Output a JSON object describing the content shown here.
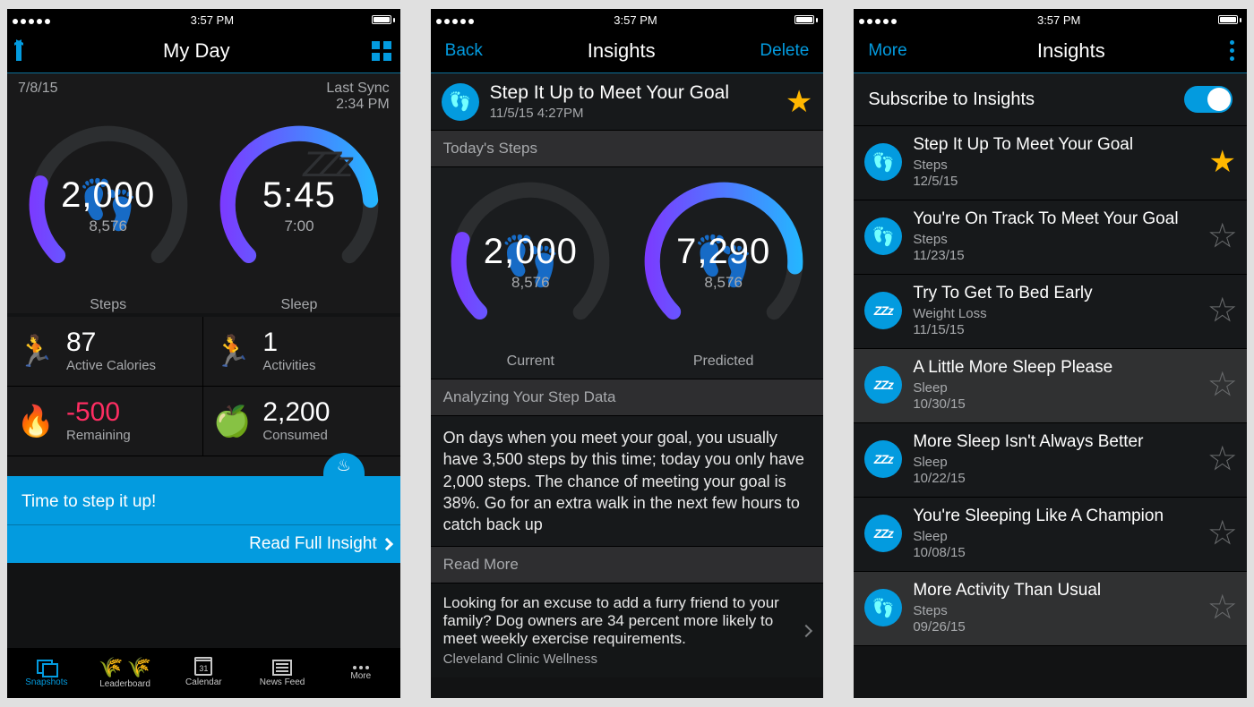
{
  "status": {
    "time": "3:57 PM"
  },
  "p1": {
    "nav": {
      "title": "My Day"
    },
    "date": "7/8/15",
    "sync_label": "Last Sync",
    "sync_time": "2:34 PM",
    "steps": {
      "value": "2,000",
      "goal": "8,576",
      "label": "Steps"
    },
    "sleep": {
      "value": "5:45",
      "goal": "7:00",
      "label": "Sleep"
    },
    "stats": {
      "cal": {
        "value": "87",
        "label": "Active Calories"
      },
      "act": {
        "value": "1",
        "label": "Activities"
      },
      "rem": {
        "value": "-500",
        "label": "Remaining"
      },
      "con": {
        "value": "2,200",
        "label": "Consumed"
      }
    },
    "banner": "Time to step it up!",
    "banner2": "Read Full Insight",
    "tabs": {
      "snapshots": "Snapshots",
      "leaderboard": "Leaderboard",
      "calendar": "Calendar",
      "caldate": "31",
      "news": "News Feed",
      "more": "More"
    }
  },
  "p2": {
    "nav": {
      "back": "Back",
      "title": "Insights",
      "delete": "Delete"
    },
    "headline": "Step It Up to Meet Your Goal",
    "headdate": "11/5/15 4:27PM",
    "sec1": "Today's Steps",
    "current": {
      "value": "2,000",
      "goal": "8,576",
      "label": "Current"
    },
    "predicted": {
      "value": "7,290",
      "goal": "8,576",
      "label": "Predicted"
    },
    "sec2": "Analyzing Your Step Data",
    "body": "On days when you meet your goal, you usually have 3,500 steps by this time; today you only have 2,000 steps. The chance of meeting your goal is 38%. Go for an extra walk in the next few hours to catch back up",
    "sec3": "Read More",
    "more_text": "Looking for an excuse to add a furry friend to your family? Dog owners are 34 percent more likely to meet weekly exercise requirements.",
    "more_src": "Cleveland Clinic Wellness"
  },
  "p3": {
    "nav": {
      "more": "More",
      "title": "Insights"
    },
    "subscribe": "Subscribe to Insights",
    "items": [
      {
        "icon": "steps",
        "title": "Step It Up To Meet Your Goal",
        "cat": "Steps",
        "date": "12/5/15",
        "star": true,
        "bold": false,
        "sel": false
      },
      {
        "icon": "steps",
        "title": "You're On Track To Meet Your Goal",
        "cat": "Steps",
        "date": "11/23/15",
        "star": false,
        "bold": false,
        "sel": false
      },
      {
        "icon": "sleep",
        "title": "Try To Get To Bed Early",
        "cat": "Weight Loss",
        "date": "11/15/15",
        "star": false,
        "bold": false,
        "sel": false
      },
      {
        "icon": "sleep",
        "title": "A Little More Sleep Please",
        "cat": "Sleep",
        "date": "10/30/15",
        "star": false,
        "bold": true,
        "sel": true
      },
      {
        "icon": "sleep",
        "title": "More Sleep Isn't Always Better",
        "cat": "Sleep",
        "date": "10/22/15",
        "star": false,
        "bold": false,
        "sel": false
      },
      {
        "icon": "sleep",
        "title": "You're Sleeping Like A Champion",
        "cat": "Sleep",
        "date": "10/08/15",
        "star": false,
        "bold": false,
        "sel": false
      },
      {
        "icon": "steps",
        "title": "More Activity Than Usual",
        "cat": "Steps",
        "date": "09/26/15",
        "star": false,
        "bold": true,
        "sel": true
      }
    ]
  },
  "chart_data": [
    {
      "type": "gauge",
      "label": "Steps",
      "value": 2000,
      "goal": 8576,
      "percent": 23
    },
    {
      "type": "gauge",
      "label": "Sleep",
      "value_minutes": 345,
      "goal_minutes": 420,
      "percent": 82
    },
    {
      "type": "gauge",
      "label": "Current",
      "value": 2000,
      "goal": 8576,
      "percent": 23
    },
    {
      "type": "gauge",
      "label": "Predicted",
      "value": 7290,
      "goal": 8576,
      "percent": 85
    }
  ]
}
